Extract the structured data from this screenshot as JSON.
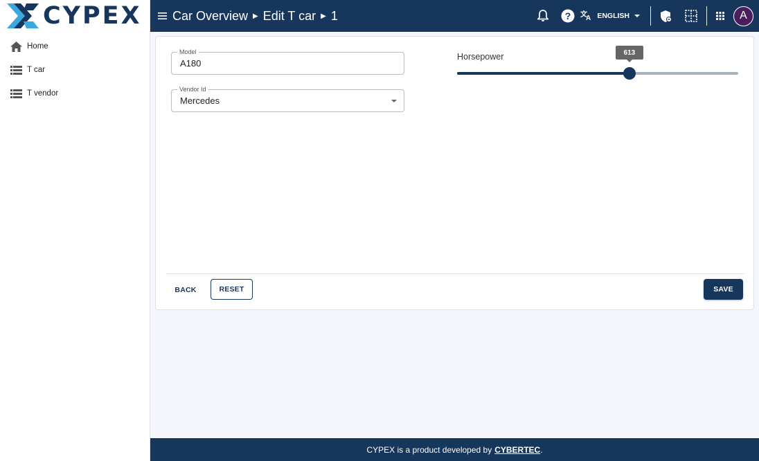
{
  "app": {
    "logo_text": "CYPEX"
  },
  "sidebar": {
    "items": [
      {
        "label": "Home",
        "icon": "home-icon"
      },
      {
        "label": "T car",
        "icon": "list-icon"
      },
      {
        "label": "T vendor",
        "icon": "list-icon"
      }
    ]
  },
  "topbar": {
    "breadcrumb": [
      "Car Overview",
      "Edit T car",
      "1"
    ],
    "language": "ENGLISH",
    "avatar_initial": "A",
    "icons": [
      "menu-icon",
      "bell-icon",
      "help-icon",
      "translate-icon",
      "chevron-down-icon",
      "shield-icon",
      "grid-edit-icon",
      "apps-icon"
    ]
  },
  "form": {
    "model": {
      "label": "Model",
      "value": "A180"
    },
    "vendor": {
      "label": "Vendor Id",
      "value": "Mercedes"
    },
    "horsepower": {
      "label": "Horsepower",
      "value": "613",
      "fraction": 0.613
    }
  },
  "actions": {
    "back": "BACK",
    "reset": "RESET",
    "save": "SAVE"
  },
  "footer": {
    "text": "CYPEX is a product developed by",
    "link": "CYBERTEC",
    "suffix": "."
  },
  "colors": {
    "primary": "#17365c",
    "accent": "#3ba9e0",
    "background": "#f5f7fd",
    "avatar": "#4a1d5e"
  }
}
